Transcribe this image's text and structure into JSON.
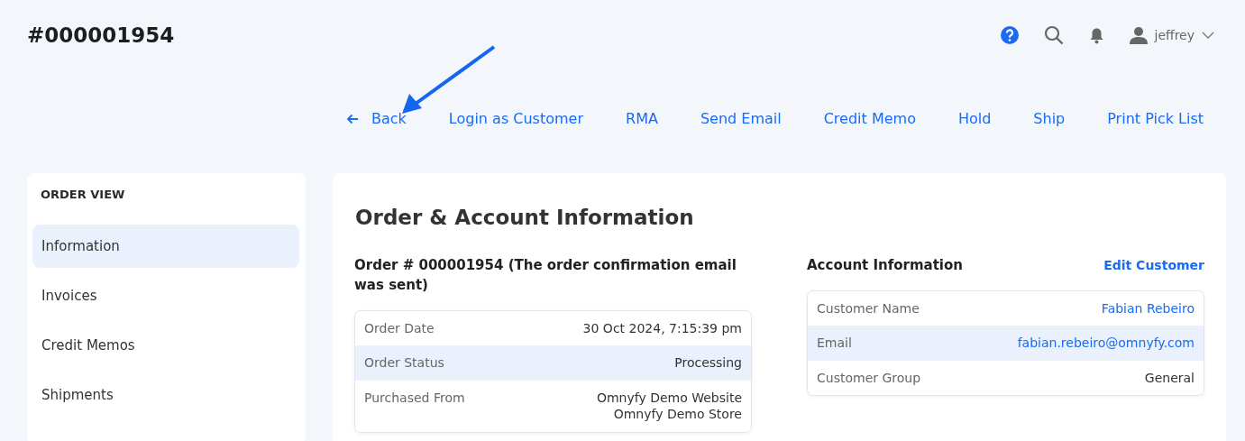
{
  "header": {
    "title": "#000001954",
    "user": {
      "name": "jeffrey"
    }
  },
  "actions": [
    {
      "label": "Back",
      "kind": "back"
    },
    {
      "label": "Login as Customer",
      "kind": "link"
    },
    {
      "label": "RMA",
      "kind": "link"
    },
    {
      "label": "Send Email",
      "kind": "link"
    },
    {
      "label": "Credit Memo",
      "kind": "link"
    },
    {
      "label": "Hold",
      "kind": "link"
    },
    {
      "label": "Ship",
      "kind": "link"
    },
    {
      "label": "Print Pick List",
      "kind": "link"
    }
  ],
  "sidebar": {
    "heading": "ORDER VIEW",
    "items": [
      {
        "label": "Information",
        "selected": true
      },
      {
        "label": "Invoices",
        "selected": false
      },
      {
        "label": "Credit Memos",
        "selected": false
      },
      {
        "label": "Shipments",
        "selected": false
      }
    ]
  },
  "main": {
    "title": "Order & Account Information",
    "order": {
      "heading": "Order # 000001954 (The order confirmation email was sent)",
      "rows": [
        {
          "label": "Order Date",
          "values": [
            "30 Oct 2024, 7:15:39 pm"
          ],
          "kind": "text"
        },
        {
          "label": "Order Status",
          "values": [
            "Processing"
          ],
          "kind": "text"
        },
        {
          "label": "Purchased From",
          "values": [
            "Omnyfy Demo Website",
            "Omnyfy Demo Store"
          ],
          "kind": "text"
        }
      ]
    },
    "account": {
      "heading": "Account Information",
      "action": "Edit Customer",
      "rows": [
        {
          "label": "Customer Name",
          "values": [
            "Fabian Rebeiro"
          ],
          "kind": "link"
        },
        {
          "label": "Email",
          "values": [
            "fabian.rebeiro@omnyfy.com"
          ],
          "kind": "link"
        },
        {
          "label": "Customer Group",
          "values": [
            "General"
          ],
          "kind": "text"
        }
      ]
    }
  }
}
